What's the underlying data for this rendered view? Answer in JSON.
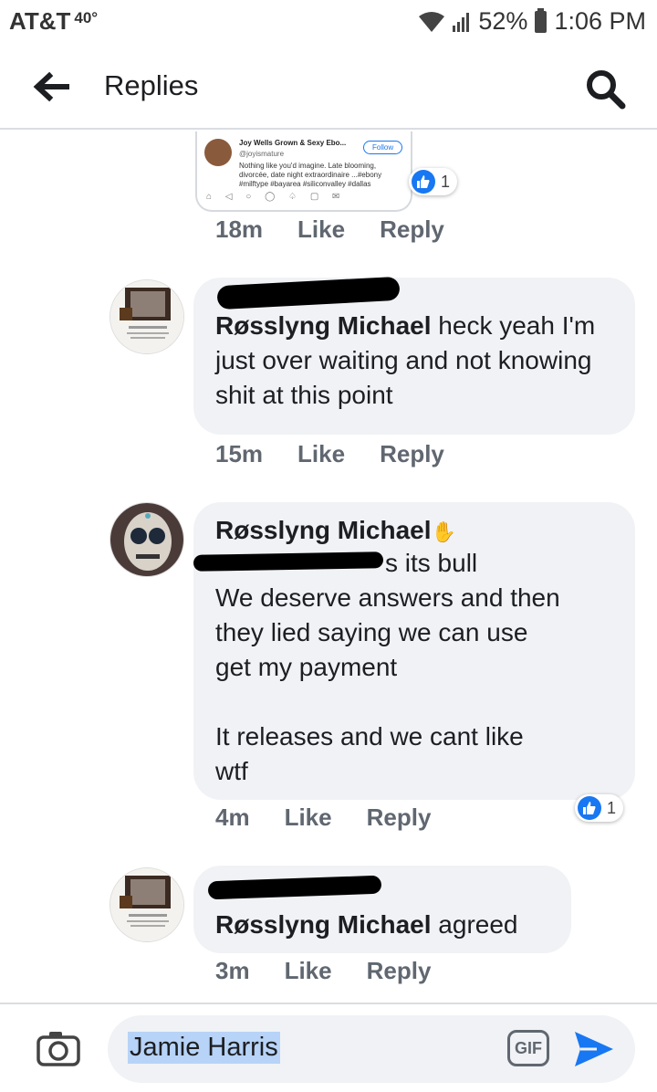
{
  "status_bar": {
    "carrier": "AT&T",
    "temperature": "40°",
    "battery": "52%",
    "time": "1:06 PM"
  },
  "header": {
    "title": "Replies",
    "back_icon": "back-arrow-icon",
    "search_icon": "search-icon"
  },
  "shared_post": {
    "name": "Joy Wells Grown & Sexy Ebo...",
    "handle": "@joyismature",
    "text": "Nothing like you'd imagine. Late blooming, divorcée, date night extraordinaire ...#ebony #milftype #bayarea #siliconvalley #dallas",
    "follow_label": "Follow",
    "reaction_count": "1"
  },
  "comments": [
    {
      "time": "18m",
      "like_label": "Like",
      "reply_label": "Reply"
    },
    {
      "mention": "Røsslyng Michael",
      "text": " heck yeah I'm just over waiting and not knowing shit at this point",
      "time": "15m",
      "like_label": "Like",
      "reply_label": "Reply"
    },
    {
      "author": "Røsslyng Michael",
      "mention_suffix": "s its bull",
      "body_lines": [
        "We deserve answers and then",
        "they lied saying we can use",
        "get my payment",
        "",
        "It releases and we cant like",
        "wtf"
      ],
      "time": "4m",
      "like_label": "Like",
      "reply_label": "Reply",
      "reaction_count": "1"
    },
    {
      "mention": "Røsslyng Michael",
      "text": " agreed",
      "time": "3m",
      "like_label": "Like",
      "reply_label": "Reply"
    }
  ],
  "composer": {
    "value": "Jamie Harris",
    "gif_label": "GIF",
    "camera_icon": "camera-icon",
    "send_icon": "send-icon"
  },
  "colors": {
    "accent": "#1877f2",
    "bubble": "#f0f2f5",
    "meta_text": "#606770",
    "selection": "#b7d3f7"
  }
}
